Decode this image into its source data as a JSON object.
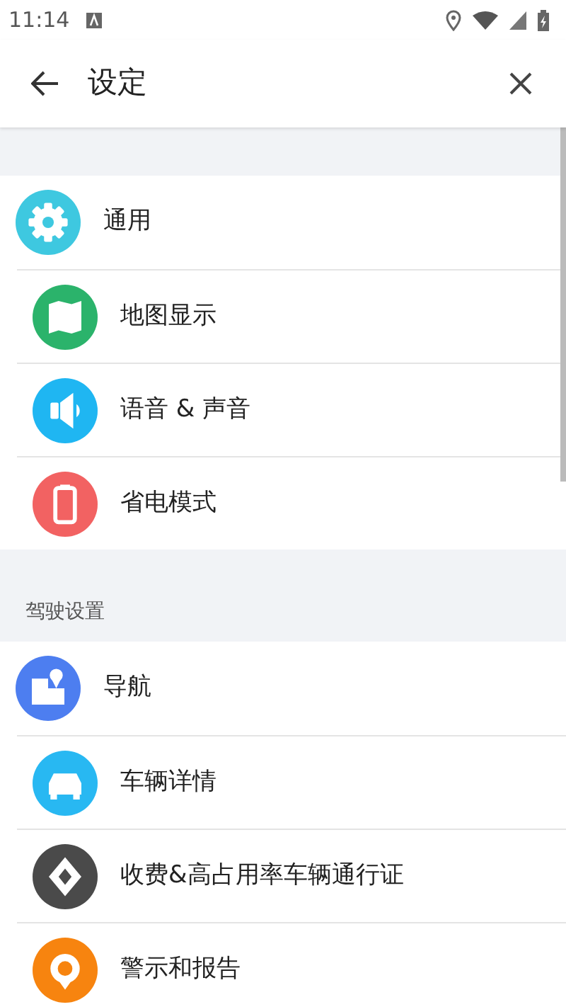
{
  "status_bar": {
    "time": "11:14"
  },
  "toolbar": {
    "title": "设定"
  },
  "sections": [
    {
      "items": [
        {
          "label": "通用",
          "kind": "gear",
          "color": "#3ec8e0"
        },
        {
          "label": "地图显示",
          "kind": "map",
          "color": "#2bb36b"
        },
        {
          "label": "语音 & 声音",
          "kind": "speaker",
          "color": "#1fb6f2"
        },
        {
          "label": "省电模式",
          "kind": "battery",
          "color": "#f26262"
        }
      ]
    },
    {
      "header": "驾驶设置",
      "items": [
        {
          "label": "导航",
          "kind": "navigation",
          "color": "#4d7ef0"
        },
        {
          "label": "车辆详情",
          "kind": "car",
          "color": "#28b8f2"
        },
        {
          "label": "收费&高占用率车辆通行证",
          "kind": "diamond",
          "color": "#4a4a4a"
        },
        {
          "label": "警示和报告",
          "kind": "pin",
          "color": "#f7840f"
        }
      ]
    }
  ]
}
